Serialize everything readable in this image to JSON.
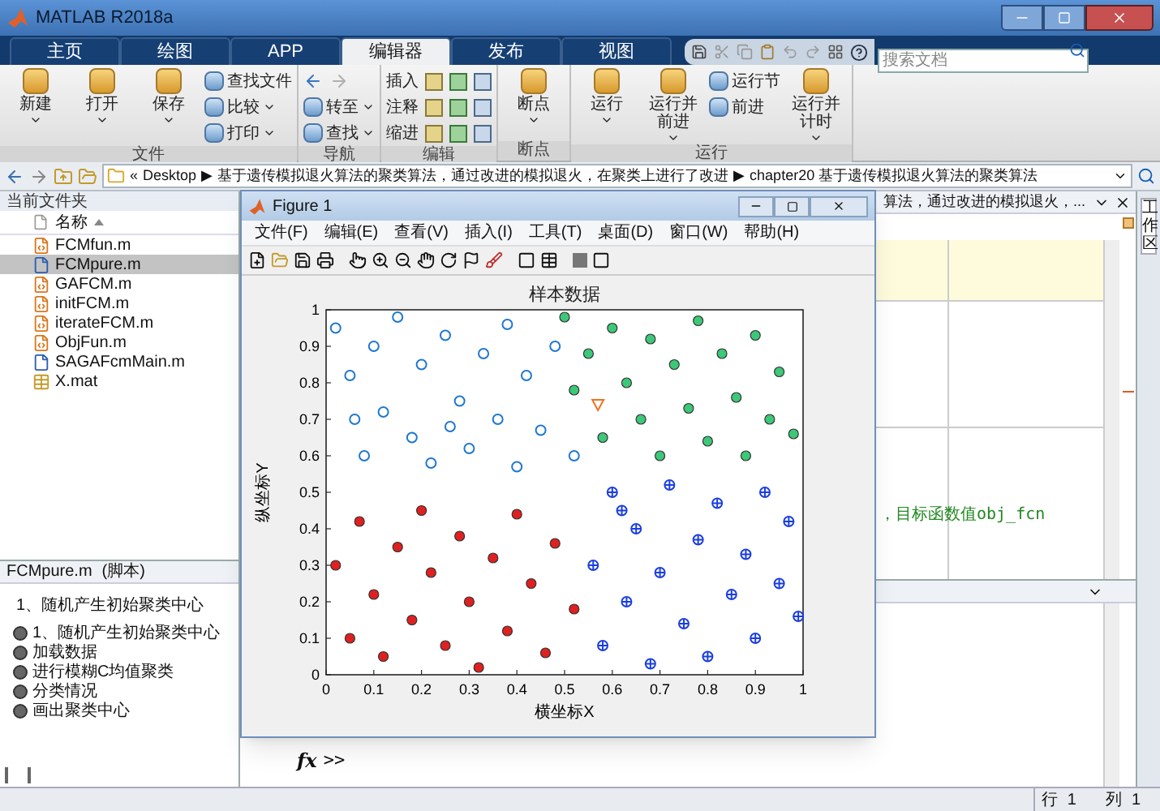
{
  "window": {
    "title": "MATLAB R2018a"
  },
  "tabs": [
    {
      "label": "主页",
      "selected": false
    },
    {
      "label": "绘图",
      "selected": false
    },
    {
      "label": "APP",
      "selected": false
    },
    {
      "label": "编辑器",
      "selected": true
    },
    {
      "label": "发布",
      "selected": false
    },
    {
      "label": "视图",
      "selected": false
    }
  ],
  "search": {
    "placeholder": "搜索文档"
  },
  "ribbon": [
    {
      "label": "文件",
      "columns": [
        [
          {
            "label": "新建",
            "kind": "large"
          }
        ],
        [
          {
            "label": "打开",
            "kind": "large"
          }
        ],
        [
          {
            "label": "保存",
            "kind": "large"
          }
        ],
        [
          {
            "label": "查找文件",
            "kind": "small",
            "dropdown": false
          },
          {
            "label": "比较",
            "kind": "small",
            "dropdown": true
          },
          {
            "label": "打印",
            "kind": "small",
            "dropdown": true
          }
        ]
      ]
    },
    {
      "label": "导航",
      "columns": [
        [
          {
            "kind": "arrows"
          },
          {
            "label": "转至",
            "kind": "small",
            "dropdown": true
          },
          {
            "label": "查找",
            "kind": "small",
            "dropdown": true
          }
        ]
      ]
    },
    {
      "label": "编辑",
      "columns": [
        [
          {
            "label": "插入",
            "kind": "row"
          },
          {
            "label": "注释",
            "kind": "row"
          },
          {
            "label": "缩进",
            "kind": "row"
          }
        ]
      ]
    },
    {
      "label": "断点",
      "columns": [
        [
          {
            "label": "断点",
            "kind": "large"
          }
        ]
      ]
    },
    {
      "label": "运行",
      "columns": [
        [
          {
            "label": "运行",
            "kind": "large"
          }
        ],
        [
          {
            "label": "运行并前进",
            "kind": "large"
          }
        ],
        [
          {
            "label": "运行节",
            "kind": "small",
            "dropdown": false
          },
          {
            "label": "前进",
            "kind": "small",
            "dropdown": false
          }
        ],
        [
          {
            "label": "运行并计时",
            "kind": "large"
          }
        ]
      ]
    }
  ],
  "path_bar": {
    "crumbs": [
      "«",
      "Desktop",
      "▶",
      "基于遗传模拟退火算法的聚类算法，通过改进的模拟退火，在聚类上进行了改进",
      "▶",
      "chapter20 基于遗传模拟退火算法的聚类算法"
    ]
  },
  "current_folder": {
    "title": "当前文件夹",
    "column": "名称",
    "files": [
      {
        "name": "FCMfun.m",
        "kind": "function",
        "selected": false
      },
      {
        "name": "FCMpure.m",
        "kind": "script",
        "selected": true
      },
      {
        "name": "GAFCM.m",
        "kind": "function",
        "selected": false
      },
      {
        "name": "initFCM.m",
        "kind": "function",
        "selected": false
      },
      {
        "name": "iterateFCM.m",
        "kind": "function",
        "selected": false
      },
      {
        "name": "ObjFun.m",
        "kind": "function",
        "selected": false
      },
      {
        "name": "SAGAFcmMain.m",
        "kind": "script",
        "selected": false
      },
      {
        "name": "X.mat",
        "kind": "data",
        "selected": false
      }
    ]
  },
  "details": {
    "title": "FCMpure.m",
    "type": "(脚本)",
    "heading": "1、随机产生初始聚类中心",
    "sections": [
      "1、随机产生初始聚类中心",
      "加载数据",
      "进行模糊C均值聚类",
      "分类情况",
      "画出聚类中心"
    ]
  },
  "editor": {
    "tab_title": "算法，通过改进的模拟退火，...",
    "code_line": "，目标函数值obj_fcn"
  },
  "command_window": {
    "prompt_icon": "fx",
    "prompt": ">>"
  },
  "workspace_tab": "工作区",
  "status_bar": {
    "row_label": "行",
    "row": "1",
    "col_label": "列",
    "col": "1"
  },
  "figure": {
    "title": "Figure 1",
    "menu": [
      "文件(F)",
      "编辑(E)",
      "查看(V)",
      "插入(I)",
      "工具(T)",
      "桌面(D)",
      "窗口(W)",
      "帮助(H)"
    ],
    "plot": {
      "chart_data": {
        "type": "scatter",
        "title": "样本数据",
        "xlabel": "横坐标X",
        "ylabel": "纵坐标Y",
        "xlim": [
          0,
          1
        ],
        "ylim": [
          0,
          1
        ],
        "xticks": [
          0,
          0.1,
          0.2,
          0.3,
          0.4,
          0.5,
          0.6,
          0.7,
          0.8,
          0.9,
          1
        ],
        "yticks": [
          0,
          0.1,
          0.2,
          0.3,
          0.4,
          0.5,
          0.6,
          0.7,
          0.8,
          0.9,
          1
        ],
        "series": [
          {
            "color": "#1f77d0",
            "x": [
              0.02,
              0.05,
              0.08,
              0.1,
              0.12,
              0.15,
              0.18,
              0.2,
              0.22,
              0.25,
              0.28,
              0.3,
              0.33,
              0.36,
              0.38,
              0.4,
              0.42,
              0.45,
              0.48,
              0.52,
              0.06,
              0.26
            ],
            "values": [
              0.95,
              0.82,
              0.6,
              0.9,
              0.72,
              0.98,
              0.65,
              0.85,
              0.58,
              0.93,
              0.75,
              0.62,
              0.88,
              0.7,
              0.96,
              0.57,
              0.82,
              0.67,
              0.9,
              0.6,
              0.7,
              0.68
            ]
          },
          {
            "color": "#3cc878",
            "x": [
              0.5,
              0.52,
              0.55,
              0.58,
              0.6,
              0.63,
              0.66,
              0.68,
              0.7,
              0.73,
              0.76,
              0.78,
              0.8,
              0.83,
              0.86,
              0.88,
              0.9,
              0.93,
              0.95,
              0.98
            ],
            "values": [
              0.98,
              0.78,
              0.88,
              0.65,
              0.95,
              0.8,
              0.7,
              0.92,
              0.6,
              0.85,
              0.73,
              0.97,
              0.64,
              0.88,
              0.76,
              0.6,
              0.93,
              0.7,
              0.83,
              0.66
            ]
          },
          {
            "color": "#e02020",
            "x": [
              0.02,
              0.05,
              0.07,
              0.1,
              0.12,
              0.15,
              0.18,
              0.2,
              0.22,
              0.25,
              0.28,
              0.3,
              0.32,
              0.35,
              0.38,
              0.4,
              0.43,
              0.46,
              0.48,
              0.52
            ],
            "values": [
              0.3,
              0.1,
              0.42,
              0.22,
              0.05,
              0.35,
              0.15,
              0.45,
              0.28,
              0.08,
              0.38,
              0.2,
              0.02,
              0.32,
              0.12,
              0.44,
              0.25,
              0.06,
              0.36,
              0.18
            ]
          },
          {
            "color": "#1a3ee0",
            "x": [
              0.56,
              0.58,
              0.6,
              0.63,
              0.65,
              0.68,
              0.7,
              0.72,
              0.75,
              0.78,
              0.8,
              0.82,
              0.85,
              0.88,
              0.9,
              0.92,
              0.95,
              0.97,
              0.99,
              0.62
            ],
            "values": [
              0.3,
              0.08,
              0.5,
              0.2,
              0.4,
              0.03,
              0.28,
              0.52,
              0.14,
              0.37,
              0.05,
              0.47,
              0.22,
              0.33,
              0.1,
              0.5,
              0.25,
              0.42,
              0.16,
              0.45
            ]
          },
          {
            "color": "#f07020",
            "x": [
              0.57
            ],
            "values": [
              0.74
            ]
          }
        ]
      }
    }
  }
}
